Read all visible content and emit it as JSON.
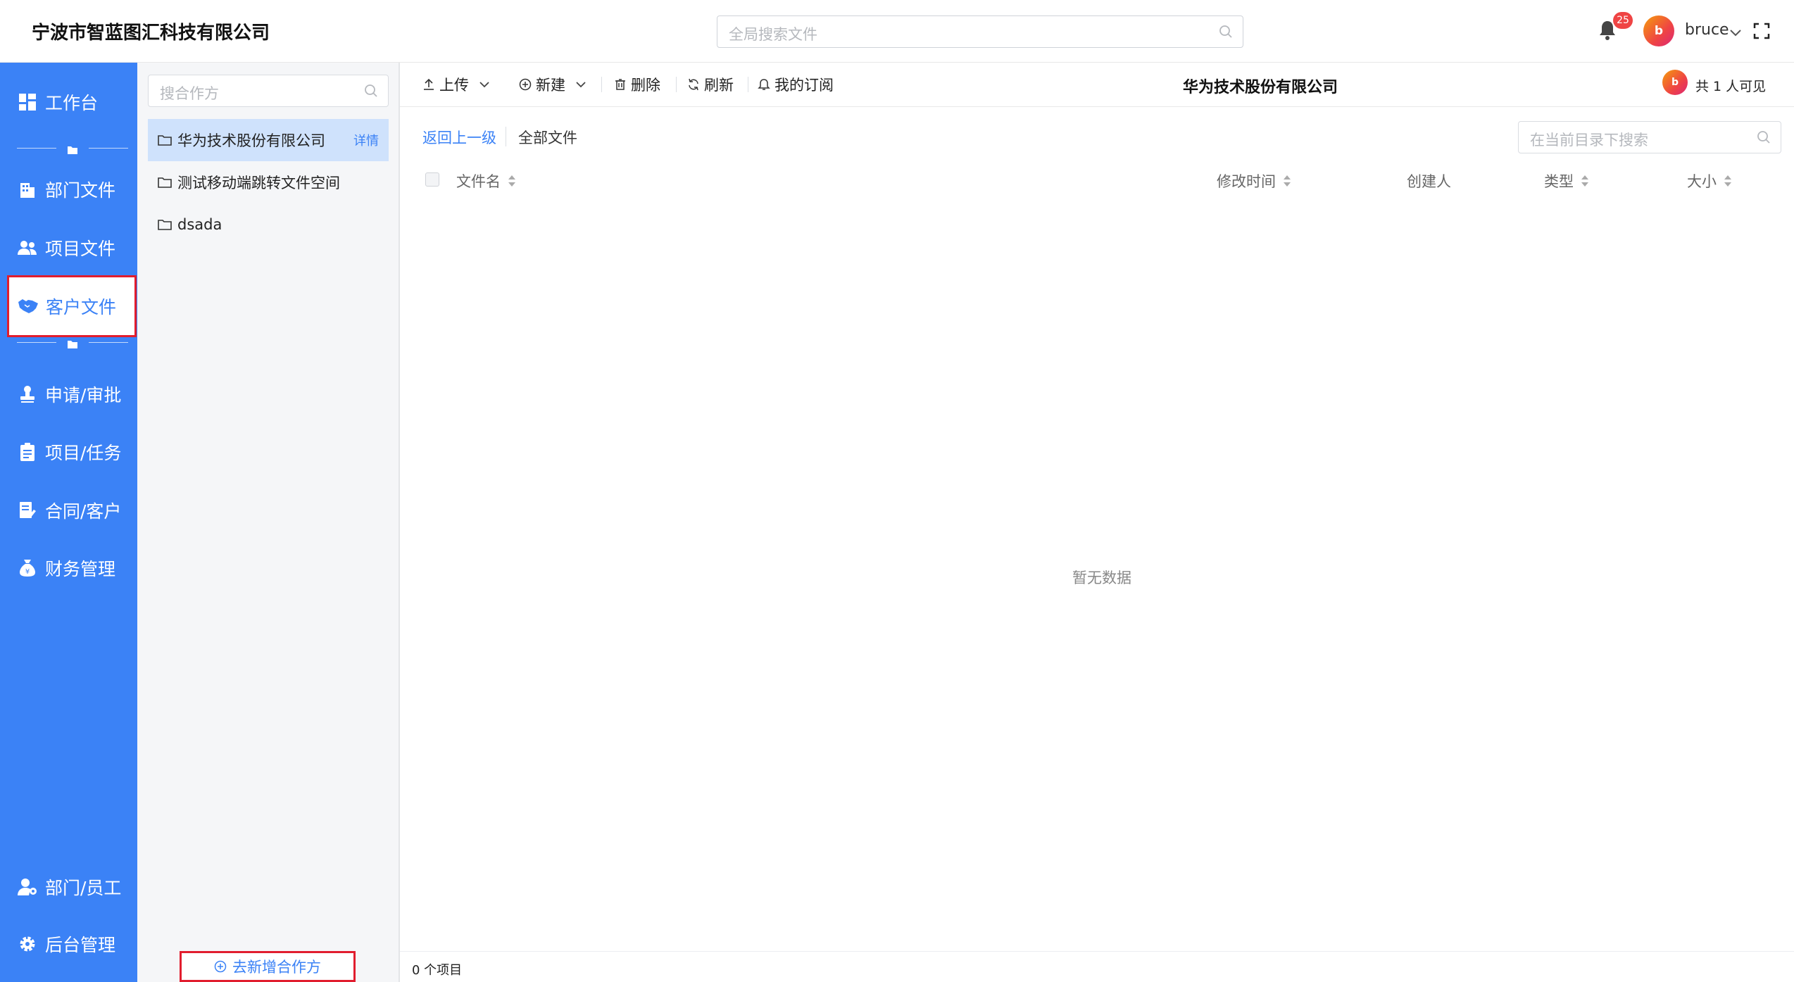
{
  "header": {
    "company_name": "宁波市智蓝图汇科技有限公司",
    "search_placeholder": "全局搜索文件",
    "notification_count": "25",
    "user_initial": "b",
    "username": "bruce"
  },
  "sidebar": {
    "items": [
      {
        "label": "工作台",
        "icon": "dashboard-icon"
      },
      {
        "label": "部门文件",
        "icon": "building-icon"
      },
      {
        "label": "项目文件",
        "icon": "team-icon"
      },
      {
        "label": "客户文件",
        "icon": "handshake-icon",
        "active": true
      },
      {
        "label": "申请/审批",
        "icon": "stamp-icon"
      },
      {
        "label": "项目/任务",
        "icon": "clipboard-icon"
      },
      {
        "label": "合同/客户",
        "icon": "contract-icon"
      },
      {
        "label": "财务管理",
        "icon": "money-bag-icon"
      },
      {
        "label": "部门/员工",
        "icon": "user-settings-icon"
      },
      {
        "label": "后台管理",
        "icon": "gear-icon"
      }
    ]
  },
  "partner_panel": {
    "search_placeholder": "搜合作方",
    "items": [
      {
        "label": "华为技术股份有限公司",
        "selected": true,
        "detail_label": "详情"
      },
      {
        "label": "测试移动端跳转文件空间"
      },
      {
        "label": "dsada"
      }
    ],
    "add_button_label": "去新增合作方"
  },
  "toolbar": {
    "upload_label": "上传",
    "new_label": "新建",
    "delete_label": "删除",
    "refresh_label": "刷新",
    "subscribe_label": "我的订阅",
    "title": "华为技术股份有限公司",
    "visibility_text": "共 1 人可见",
    "visibility_avatar": "b"
  },
  "browser": {
    "back_label": "返回上一级",
    "all_files_label": "全部文件",
    "dir_search_placeholder": "在当前目录下搜索",
    "columns": [
      "文件名",
      "修改时间",
      "创建人",
      "类型",
      "大小"
    ],
    "empty_text": "暂无数据",
    "item_count": "0 个项目"
  },
  "colors": {
    "primary": "#3b82f6",
    "highlight_border": "#e11d2e",
    "badge": "#ef4444"
  }
}
